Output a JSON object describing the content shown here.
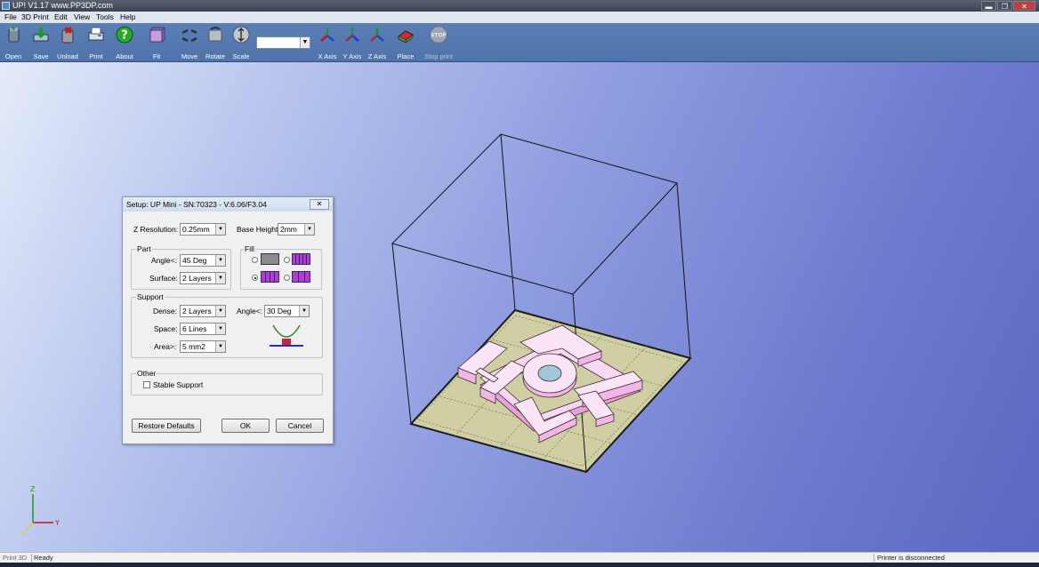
{
  "window": {
    "title": "UP!  V1.17   www.PP3DP.com",
    "controls": {
      "minimize": "▬",
      "restore": "❐",
      "close": "✕"
    }
  },
  "menu": [
    "File",
    "3D Print",
    "Edit",
    "View",
    "Tools",
    "Help"
  ],
  "toolbar": {
    "buttons": [
      {
        "label": "Open",
        "icon": "open-icon",
        "enabled": true
      },
      {
        "label": "Save",
        "icon": "save-icon",
        "enabled": true
      },
      {
        "label": "Unload",
        "icon": "unload-icon",
        "enabled": true
      },
      {
        "label": "Print",
        "icon": "print-icon",
        "enabled": true
      },
      {
        "label": "About",
        "icon": "about-icon",
        "enabled": true
      },
      {
        "label": "Fit",
        "icon": "fit-icon",
        "enabled": true
      },
      {
        "label": "Move",
        "icon": "move-icon",
        "enabled": true
      },
      {
        "label": "Rotate",
        "icon": "rotate-icon",
        "enabled": true
      },
      {
        "label": "Scale",
        "icon": "scale-icon",
        "enabled": true
      },
      {
        "label": "X Axis",
        "icon": "x-axis-icon",
        "enabled": true
      },
      {
        "label": "Y Axis",
        "icon": "y-axis-icon",
        "enabled": true
      },
      {
        "label": "Z Axis",
        "icon": "z-axis-icon",
        "enabled": true
      },
      {
        "label": "Place",
        "icon": "place-icon",
        "enabled": true
      },
      {
        "label": "Stop print",
        "icon": "stop-print-icon",
        "enabled": false
      }
    ],
    "value_combo": ""
  },
  "dialog": {
    "title": "Setup: UP Mini - SN:70323 - V:6.06/F3.04",
    "z_resolution": {
      "label": "Z Resolution:",
      "value": "0.25mm"
    },
    "base_height": {
      "label": "Base Height:",
      "value": "2mm"
    },
    "part": {
      "legend": "Part",
      "angle": {
        "label": "Angle<:",
        "value": "45 Deg"
      },
      "surface": {
        "label": "Surface:",
        "value": "2 Layers"
      }
    },
    "fill": {
      "legend": "Fill",
      "selected_index": 2
    },
    "support": {
      "legend": "Support",
      "dense": {
        "label": "Dense:",
        "value": "2 Layers"
      },
      "space": {
        "label": "Space:",
        "value": "6 Lines"
      },
      "area": {
        "label": "Area>:",
        "value": "5 mm2"
      },
      "angle": {
        "label": "Angle<:",
        "value": "30 Deg"
      }
    },
    "other": {
      "legend": "Other",
      "stable_support": {
        "label": "Stable Support",
        "checked": false
      }
    },
    "buttons": {
      "restore": "Restore Defaults",
      "ok": "OK",
      "cancel": "Cancel"
    }
  },
  "viewport": {
    "model_text": "HOT",
    "axis_labels": {
      "x": "X",
      "y": "Y",
      "z": "Z"
    }
  },
  "status": {
    "left": "Print 3D",
    "state": "Ready",
    "printer": "Printer is disconnected"
  },
  "colors": {
    "toolbar": "#5278b0",
    "model": "#f5b6e6",
    "platform": "#cfcfa3",
    "fill_swatch": "#b83ad6"
  }
}
